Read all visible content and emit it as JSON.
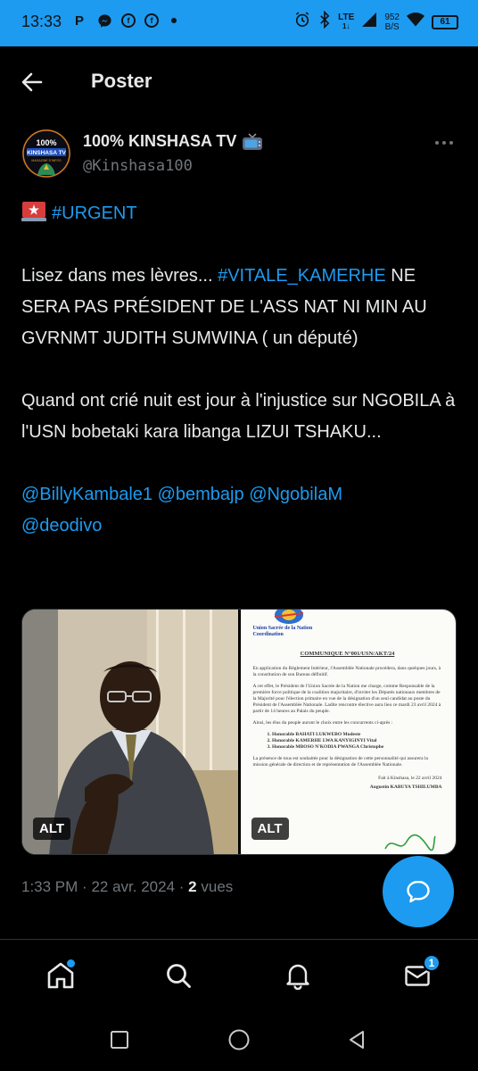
{
  "status_bar": {
    "time": "13:33",
    "app_icons": [
      "P",
      "messenger",
      "facebook",
      "facebook"
    ],
    "network": "LTE",
    "network_sub": "1↓",
    "speed_value": "952",
    "speed_unit": "B/S",
    "battery": "61"
  },
  "header": {
    "title": "Poster"
  },
  "tweet": {
    "author_name": "100% KINSHASA TV",
    "author_handle": "@Kinshasa100",
    "avatar_text_top": "100%",
    "avatar_text_mid": "KINSHASA TV",
    "avatar_text_low": "MAGAZINE D'INFOS",
    "urgent_hashtag": "#URGENT",
    "p2_prefix": "Lisez dans mes lèvres... ",
    "p2_hashtag": "#VITALE_KAMERHE",
    "p2_rest": "NE SERA PAS PRÉSIDENT DE L'ASS NAT NI MIN AU GVRNMT JUDITH SUMWINA ( un député)",
    "p3": "Quand ont crié nuit est jour à l'injustice sur NGOBILA à l'USN bobetaki kara libanga LIZUI TSHAKU...",
    "mentions": [
      "@BillyKambale1",
      "@bembajp",
      "@NgobilaM",
      "@deodivo"
    ],
    "media": {
      "alt_label_1": "ALT",
      "alt_label_2": "ALT",
      "doc": {
        "org_line1": "Union Sacrée de la Nation",
        "org_line2": "Coordination",
        "title": "COMMUNIQUE N°001/USN/AKT/24",
        "para1": "En application du Règlement Intérieur, l'Assemblée Nationale procédera, dans quelques jours, à la constitution de son Bureau définitif.",
        "para2": "A cet effet, le Président de l'Union Sacrée de la Nation me charge, comme Responsable de la première force politique de la coalition majoritaire, d'inviter les Députés nationaux membres de la Majorité pour l'élection primaire en vue de la désignation d'un seul candidat au poste du Président de l'Assemblée Nationale. Ladite rencontre élective aura lieu ce mardi 23 avril 2024 à partir de 14 heures au Palais du peuple.",
        "para3": "Ainsi, les élus du peuple auront le choix entre les concurrents ci-après :",
        "candidates": [
          "1. Honorable BAHATI LUKWEBO Modeste",
          "2. Honorable KAMERHE LWA KANYIGINYI Vital",
          "3. Honorable MBOSO N'KODIA PWANGA Christophe"
        ],
        "para4": "La présence de tous est souhaitée pour la désignation de cette personnalité qui assurera la mission générale de direction et de représentation de l'Assemblée Nationale.",
        "place_date": "Fait à Kinshasa, le 22 avril 2024",
        "signatory": "Augustin KABUYA TSHILUMBA"
      }
    },
    "time": "1:33 PM",
    "separator": "·",
    "date": "22 avr. 2024",
    "views_count": "2",
    "views_label": "vues"
  },
  "bottom_nav": {
    "messages_badge": "1"
  },
  "colors": {
    "accent": "#1d9bf0",
    "background": "#000000",
    "text": "#e7e9ea",
    "muted": "#71767b"
  },
  "icons": {
    "back": "arrow-left-icon",
    "more": "more-horizontal-icon",
    "home": "home-icon",
    "search": "search-icon",
    "notifications": "bell-icon",
    "messages": "mail-icon",
    "compose": "chat-bubble-icon"
  }
}
